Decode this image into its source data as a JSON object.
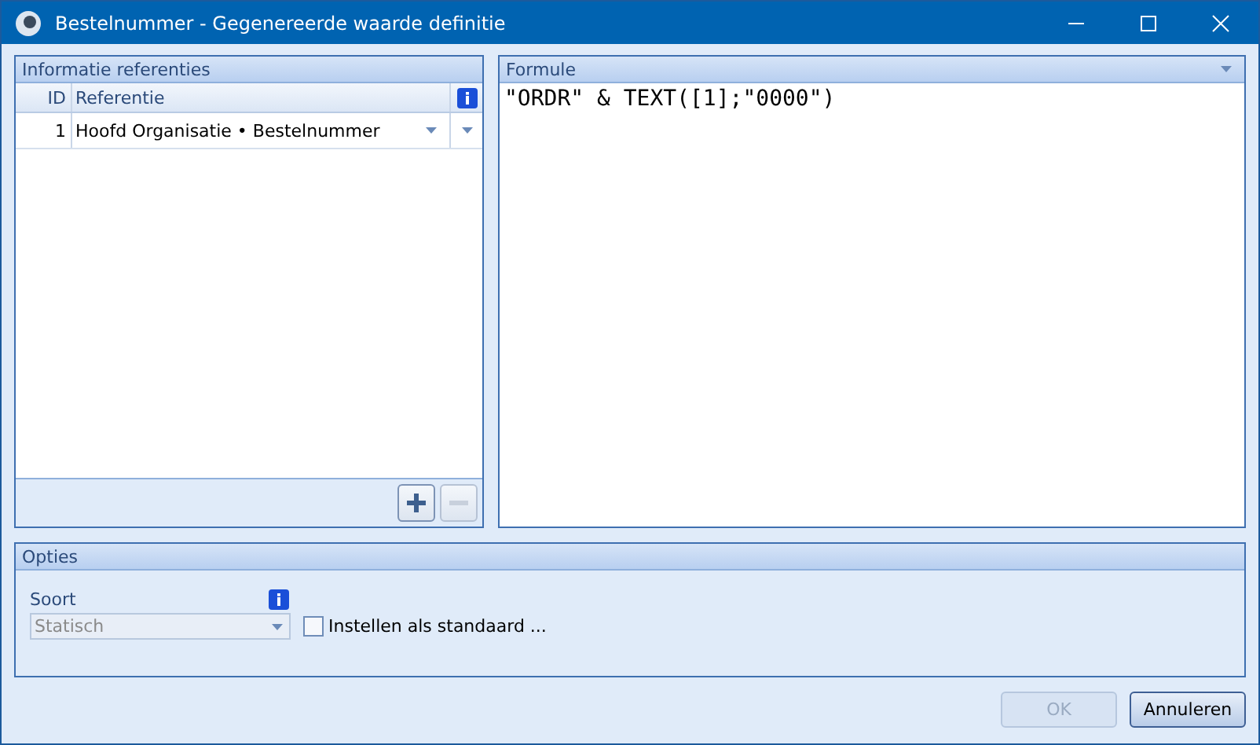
{
  "window": {
    "title": "Bestelnummer - Gegenereerde waarde definitie"
  },
  "references": {
    "title": "Informatie referenties",
    "columns": [
      "ID",
      "Referentie"
    ],
    "rows": [
      {
        "id": "1",
        "reference": "Hoofd Organisatie • Bestelnummer"
      }
    ],
    "add_button": {
      "disabled": false
    },
    "remove_button": {
      "disabled": true
    }
  },
  "formula": {
    "title": "Formule",
    "text": "\"ORDR\" & TEXT([1];\"0000\")"
  },
  "options": {
    "title": "Opties",
    "type_label": "Soort",
    "type_select": {
      "value": "Statisch",
      "disabled": true
    },
    "default_checkbox": {
      "label": "Instellen als standaard ...",
      "checked": false
    }
  },
  "buttons": [
    {
      "label": "OK",
      "disabled": true
    },
    {
      "label": "Annuleren",
      "disabled": false
    }
  ]
}
